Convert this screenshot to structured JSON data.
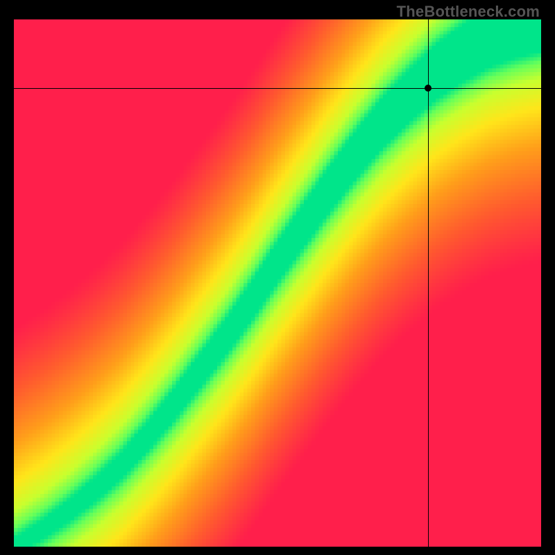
{
  "watermark": "TheBottleneck.com",
  "chart_data": {
    "type": "heatmap",
    "title": "",
    "xlabel": "",
    "ylabel": "",
    "xlim": [
      0,
      1
    ],
    "ylim": [
      0,
      1
    ],
    "colormap": {
      "description": "compatibility score; 0=bottleneck (red), 1=balanced (green)",
      "stops": [
        {
          "value": 0.0,
          "color": "#ff1f4b"
        },
        {
          "value": 0.25,
          "color": "#ff5a2e"
        },
        {
          "value": 0.5,
          "color": "#ff9e1a"
        },
        {
          "value": 0.7,
          "color": "#ffe51a"
        },
        {
          "value": 0.85,
          "color": "#c8ff2e"
        },
        {
          "value": 0.94,
          "color": "#66ff5a"
        },
        {
          "value": 1.0,
          "color": "#00e58a"
        }
      ]
    },
    "ridge": {
      "description": "locus of balanced CPU/GPU pairs (green band centerline), y as function of x",
      "points": [
        {
          "x": 0.0,
          "y": 0.0
        },
        {
          "x": 0.05,
          "y": 0.03
        },
        {
          "x": 0.1,
          "y": 0.065
        },
        {
          "x": 0.15,
          "y": 0.105
        },
        {
          "x": 0.2,
          "y": 0.15
        },
        {
          "x": 0.25,
          "y": 0.205
        },
        {
          "x": 0.3,
          "y": 0.265
        },
        {
          "x": 0.35,
          "y": 0.33
        },
        {
          "x": 0.4,
          "y": 0.395
        },
        {
          "x": 0.45,
          "y": 0.465
        },
        {
          "x": 0.5,
          "y": 0.54
        },
        {
          "x": 0.55,
          "y": 0.61
        },
        {
          "x": 0.6,
          "y": 0.68
        },
        {
          "x": 0.65,
          "y": 0.745
        },
        {
          "x": 0.7,
          "y": 0.805
        },
        {
          "x": 0.75,
          "y": 0.855
        },
        {
          "x": 0.8,
          "y": 0.9
        },
        {
          "x": 0.85,
          "y": 0.935
        },
        {
          "x": 0.9,
          "y": 0.965
        },
        {
          "x": 0.95,
          "y": 0.985
        },
        {
          "x": 1.0,
          "y": 1.0
        }
      ],
      "band_halfwidth_base": 0.015,
      "band_halfwidth_slope": 0.045
    },
    "marker": {
      "x": 0.785,
      "y": 0.87
    },
    "crosshair": {
      "x": 0.785,
      "y": 0.87
    },
    "resolution": 140
  }
}
